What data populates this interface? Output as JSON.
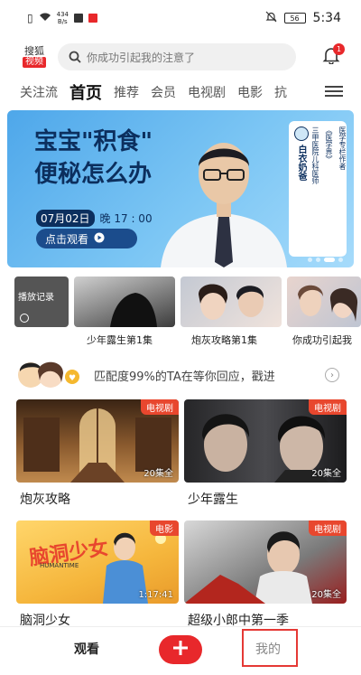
{
  "status": {
    "speed_value": "434",
    "speed_unit": "B/s",
    "battery": "56",
    "time": "5:34"
  },
  "header": {
    "logo_line1": "搜狐",
    "logo_line2": "视频",
    "search_placeholder": "你成功引起我的注意了",
    "bell_badge": "1"
  },
  "nav": {
    "tabs": [
      "关注流",
      "首页",
      "推荐",
      "会员",
      "电视剧",
      "电影",
      "抗"
    ],
    "active": "首页"
  },
  "banner": {
    "title_line1": "宝宝\"积食\"",
    "title_line2": "便秘怎么办",
    "date": "07月02日",
    "time": "晚 17 : 00",
    "button": "点击观看",
    "side_name": "白衣奶爸",
    "side_tag1": "《医学界》",
    "side_tag2": "医学专栏作者",
    "side_tag3": "三甲医院儿科医师"
  },
  "history": {
    "items": [
      {
        "label": "播放记录"
      },
      {
        "label": "少年露生第1集"
      },
      {
        "label": "炮灰攻略第1集"
      },
      {
        "label": "你成功引起我"
      }
    ]
  },
  "promo": {
    "text": "匹配度99%的TA在等你回应，戳进"
  },
  "cards": [
    {
      "title": "炮灰攻略",
      "tag": "电视剧",
      "episodes": "20集全"
    },
    {
      "title": "少年露生",
      "tag": "电视剧",
      "episodes": "20集全"
    },
    {
      "title": "脑洞少女",
      "tag": "电影",
      "episodes": "1:17:41",
      "poster_title": "脑洞少女",
      "poster_sub": "HUMANTIME"
    },
    {
      "title": "超级小郎中第一季",
      "tag": "电视剧",
      "episodes": "20集全"
    }
  ],
  "bottom": {
    "watch": "观看",
    "mine": "我的"
  },
  "colors": {
    "accent": "#e8282b",
    "banner": "#4ea7ea",
    "highlight": "#e53935"
  }
}
